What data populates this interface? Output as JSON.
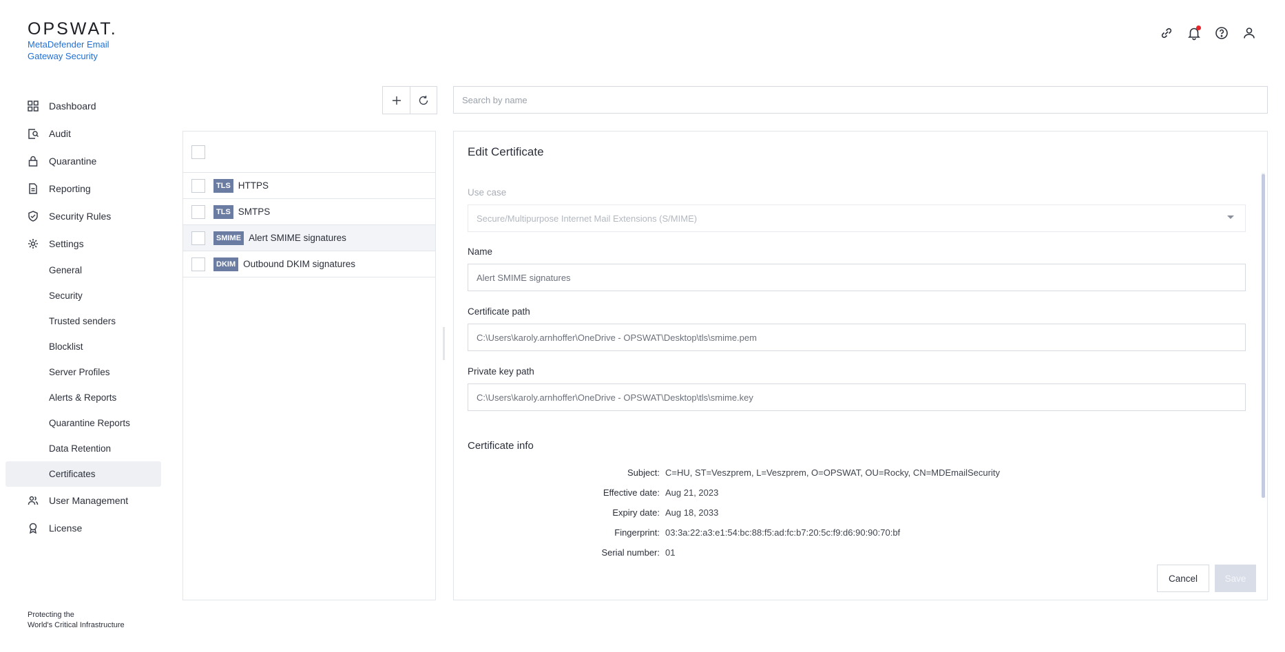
{
  "brand": {
    "logo": "OPSWAT.",
    "product": "MetaDefender Email Gateway Security",
    "tagline_line1": "Protecting the",
    "tagline_line2": "World's Critical Infrastructure"
  },
  "nav": {
    "dashboard": "Dashboard",
    "audit": "Audit",
    "quarantine": "Quarantine",
    "reporting": "Reporting",
    "security_rules": "Security Rules",
    "settings": "Settings",
    "settings_items": [
      "General",
      "Security",
      "Trusted senders",
      "Blocklist",
      "Server Profiles",
      "Alerts & Reports",
      "Quarantine Reports",
      "Data Retention",
      "Certificates"
    ],
    "user_management": "User Management",
    "license": "License"
  },
  "header_icons": [
    "link-icon",
    "bell-icon",
    "help-icon",
    "user-icon"
  ],
  "search": {
    "placeholder": "Search by name",
    "value": ""
  },
  "list": {
    "rows": [
      {
        "tag": "TLS",
        "label": "HTTPS"
      },
      {
        "tag": "TLS",
        "label": "SMTPS"
      },
      {
        "tag": "SMIME",
        "label": "Alert SMIME signatures"
      },
      {
        "tag": "DKIM",
        "label": "Outbound DKIM signatures"
      }
    ],
    "selected_index": 2
  },
  "edit": {
    "title": "Edit Certificate",
    "use_case_label": "Use case",
    "use_case_value": "Secure/Multipurpose Internet Mail Extensions (S/MIME)",
    "name_label": "Name",
    "name_value": "Alert SMIME signatures",
    "cert_path_label": "Certificate path",
    "cert_path_value": "C:\\Users\\karoly.arnhoffer\\OneDrive - OPSWAT\\Desktop\\tls\\smime.pem",
    "key_path_label": "Private key path",
    "key_path_value": "C:\\Users\\karoly.arnhoffer\\OneDrive - OPSWAT\\Desktop\\tls\\smime.key",
    "info_title": "Certificate info",
    "info": {
      "subject_label": "Subject:",
      "subject": "C=HU, ST=Veszprem, L=Veszprem, O=OPSWAT, OU=Rocky, CN=MDEmailSecurity",
      "effective_label": "Effective date:",
      "effective": "Aug 21, 2023",
      "expiry_label": "Expiry date:",
      "expiry": "Aug 18, 2033",
      "fingerprint_label": "Fingerprint:",
      "fingerprint": "03:3a:22:a3:e1:54:bc:88:f5:ad:fc:b7:20:5c:f9:d6:90:90:70:bf",
      "serial_label": "Serial number:",
      "serial": "01"
    },
    "cancel_label": "Cancel",
    "save_label": "Save"
  },
  "colors": {
    "accent": "#1d6fd6",
    "tag_bg": "#6b7ca3",
    "notif": "#e5252a"
  }
}
